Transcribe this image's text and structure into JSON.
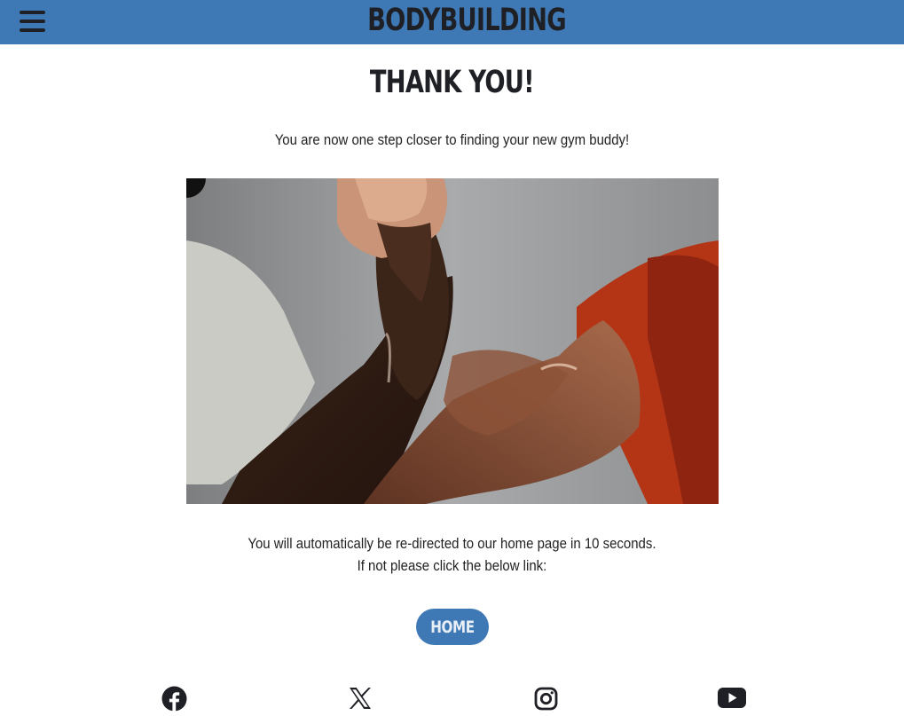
{
  "header": {
    "brand": "BODYBUILDING",
    "menu_icon": "hamburger-menu-icon",
    "background_color": "#3f79b5"
  },
  "main": {
    "title": "THANK YOU!",
    "intro": "You are now one step closer to finding your new gym buddy!",
    "image_alt": "two muscular arms clasping hands",
    "redirect_line1": "You will automatically be re-directed to our home page in 10 seconds.",
    "redirect_line2": "If not please click the below link:",
    "home_button": "HOME"
  },
  "footer": {
    "social": [
      {
        "name": "facebook",
        "icon": "facebook-icon"
      },
      {
        "name": "x",
        "icon": "x-twitter-icon"
      },
      {
        "name": "instagram",
        "icon": "instagram-icon"
      },
      {
        "name": "youtube",
        "icon": "youtube-icon"
      }
    ]
  },
  "colors": {
    "accent": "#3f79b5",
    "text_dark": "#1f2026",
    "button_text": "#e8eef6"
  }
}
